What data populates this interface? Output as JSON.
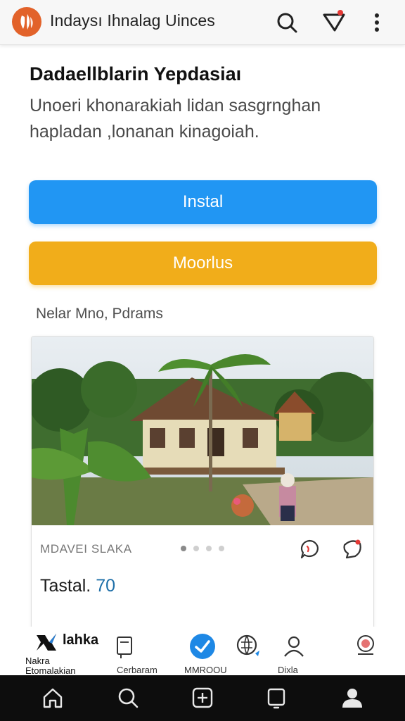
{
  "header": {
    "title": "Indaysı Ihnalag Uinces",
    "icons": [
      "app-logo",
      "search-icon",
      "filter-icon",
      "more-vert-icon"
    ]
  },
  "intro": {
    "headline": "Dadaellblarin Yepdasiaı",
    "subtext": "Unoeri khonarakiah lidan sasgrnghan hapladan ,lonanan kinagoiah."
  },
  "actions": {
    "primary_label": "Instal",
    "secondary_label": "Moorlus"
  },
  "section": {
    "label": "Nelar Mno, Pdrams"
  },
  "card": {
    "meta": "MDAVEI SLAKA",
    "total_label": "Tastal.",
    "total_value": "70",
    "carousel_index": 1,
    "carousel_count": 4,
    "icons": [
      "comment-icon",
      "chat-bubble-icon"
    ]
  },
  "shortcuts": {
    "brand_name": "lahka",
    "brand_sub_1": "Nakra",
    "brand_sub_2": "Etomalakian",
    "labels": [
      "Cerbaram",
      "MMROOU",
      "Dixla"
    ]
  },
  "bottom_nav": {
    "items": [
      "home-icon",
      "search-icon",
      "add-box-icon",
      "tablet-icon",
      "profile-icon"
    ]
  },
  "colors": {
    "primary": "#2196f3",
    "secondary": "#f1ad1a",
    "logo": "#e2622a",
    "nav_bg": "#0d0d0d"
  }
}
